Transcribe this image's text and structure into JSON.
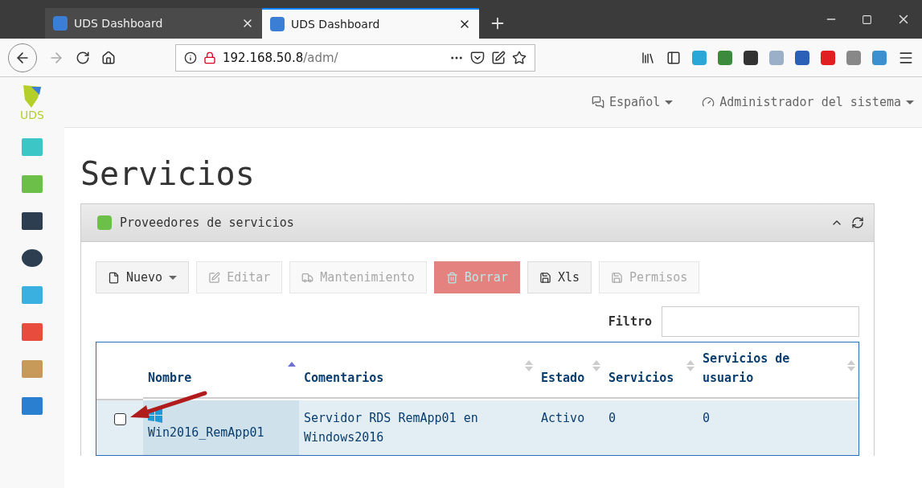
{
  "browser": {
    "tabs": [
      {
        "title": "UDS Dashboard",
        "selected": false
      },
      {
        "title": "UDS Dashboard",
        "selected": true
      }
    ],
    "url": {
      "host": "192.168.50.8",
      "path": "/adm/"
    }
  },
  "navbar": {
    "logo": "UDS",
    "language": "Español",
    "user": "Administrador del sistema"
  },
  "title": "Servicios",
  "panel": {
    "title": "Proveedores de servicios",
    "buttons": [
      {
        "label": "Nuevo",
        "kind": "dropdown",
        "disabled": false
      },
      {
        "label": "Editar",
        "kind": "default",
        "disabled": true
      },
      {
        "label": "Mantenimiento",
        "kind": "default",
        "disabled": true
      },
      {
        "label": "Borrar",
        "kind": "danger",
        "disabled": true
      },
      {
        "label": "Xls",
        "kind": "default",
        "disabled": false
      },
      {
        "label": "Permisos",
        "kind": "default",
        "disabled": true
      }
    ],
    "filter": {
      "label": "Filtro"
    },
    "table": {
      "columns": [
        {
          "label": "Nombre",
          "sorted": true
        },
        {
          "label": "Comentarios",
          "sorted": false
        },
        {
          "label": "Estado",
          "sorted": false
        },
        {
          "label": "Servicios",
          "sorted": false
        },
        {
          "label": "Servicios de usuario",
          "sorted": false
        }
      ],
      "rows": [
        {
          "checked": false,
          "name": "Win2016_RemApp01",
          "comment": "Servidor RDS RemApp01 en Windows2016",
          "state": "Activo",
          "services": "0",
          "user_services": "0"
        }
      ]
    }
  }
}
